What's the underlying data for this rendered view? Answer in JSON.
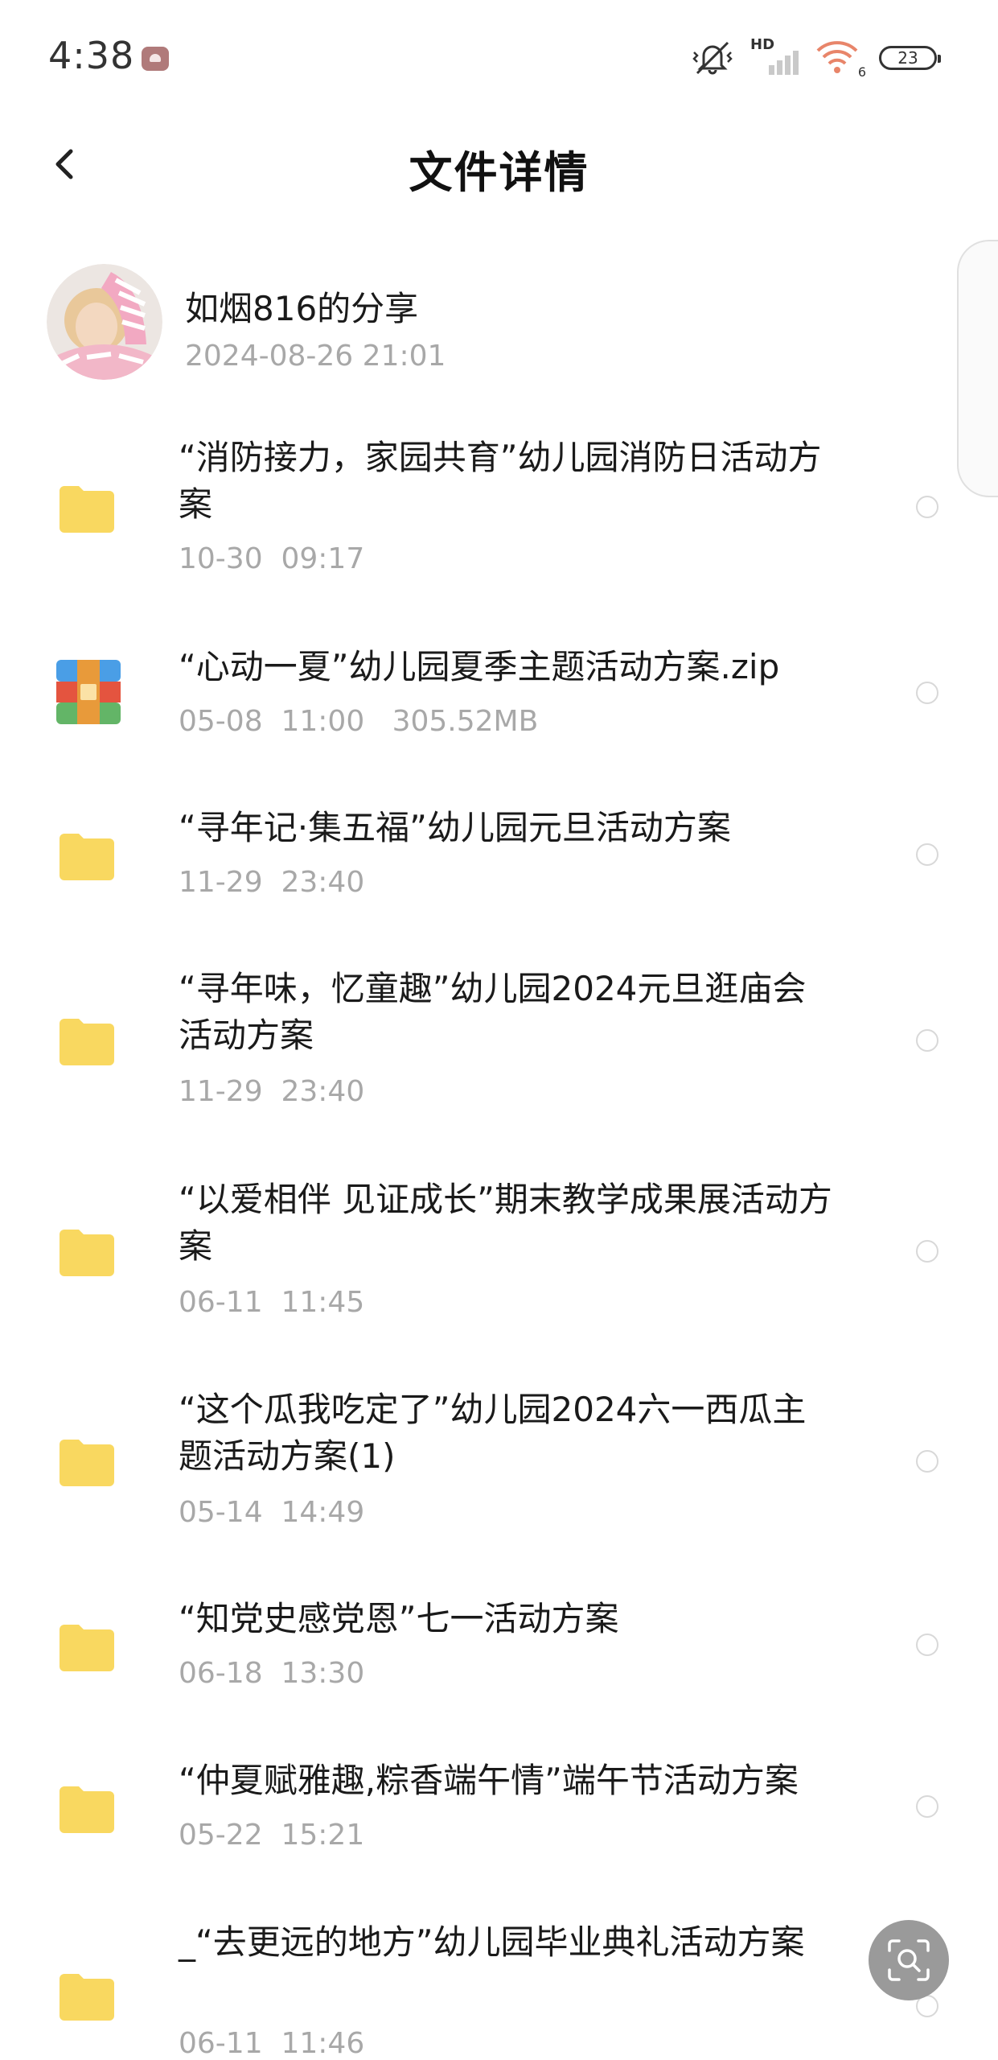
{
  "status_bar": {
    "time": "4:38",
    "network_label": "HD",
    "wifi_label": "6",
    "battery": "23"
  },
  "header": {
    "title": "文件详情"
  },
  "share": {
    "title": "如烟816的分享",
    "datetime": "2024-08-26  21:01"
  },
  "files": [
    {
      "type": "folder",
      "name": "“消防接力，家园共育”幼儿园消防日活动方案",
      "meta": "10-30  09:17"
    },
    {
      "type": "zip",
      "name": "“心动一夏”幼儿园夏季主题活动方案.zip",
      "meta": "05-08  11:00   305.52MB"
    },
    {
      "type": "folder",
      "name": "“寻年记·集五福”幼儿园元旦活动方案",
      "meta": "11-29  23:40"
    },
    {
      "type": "folder",
      "name": "“寻年味，忆童趣”幼儿园2024元旦逛庙会活动方案",
      "meta": "11-29  23:40"
    },
    {
      "type": "folder",
      "name": "“以爱相伴 见证成长”期末教学成果展活动方案",
      "meta": "06-11  11:45"
    },
    {
      "type": "folder",
      "name": "“这个瓜我吃定了”幼儿园2024六一西瓜主题活动方案(1)",
      "meta": "05-14  14:49"
    },
    {
      "type": "folder",
      "name": "“知党史感党恩”七一活动方案",
      "meta": "06-18  13:30"
    },
    {
      "type": "folder",
      "name": "“仲夏赋雅趣,粽香端午情”端午节活动方案",
      "meta": "05-22  15:21"
    },
    {
      "type": "folder",
      "name": "_“去更远的地方”幼儿园毕业典礼活动方案",
      "meta": "06-11  11:46"
    }
  ],
  "colors": {
    "folder": "#f9d860",
    "meta_text": "#a8a8a8",
    "radio_border": "#d8d8d8"
  },
  "icons": {
    "back": "chevron-left-icon",
    "folder": "folder-icon",
    "zip": "archive-icon",
    "float": "search-scan-icon"
  }
}
